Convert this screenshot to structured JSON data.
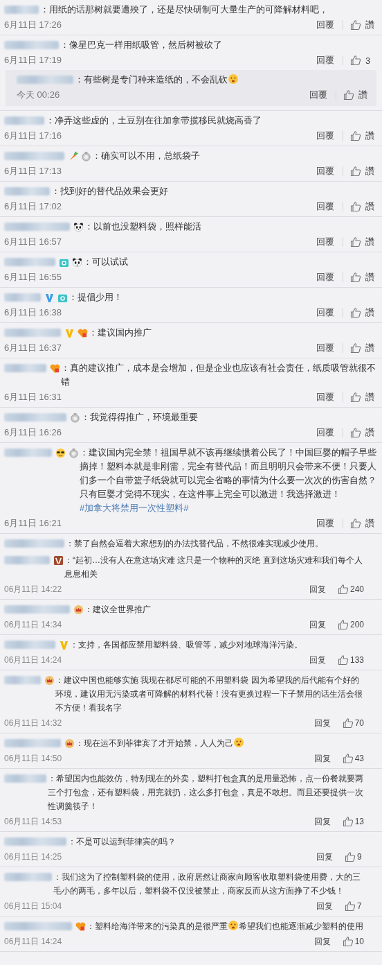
{
  "sections": [
    {
      "kind": "a",
      "comments": [
        {
          "segments": [
            {
              "kind": "text",
              "text": "：用纸的话那树就要遭殃了，还是尽快研制可大量生产的可降解材料吧，"
            }
          ],
          "time": "6月11日 17:26",
          "reply": "回覆",
          "like": "讚"
        },
        {
          "segments": [
            {
              "kind": "text",
              "text": "：像星巴克一样用纸吸管，然后树被砍了"
            }
          ],
          "time": "6月11日 17:19",
          "reply": "回覆",
          "like": "3",
          "replies": [
            {
              "segments": [
                {
                  "kind": "text",
                  "text": "：有些树是专门种来造纸的，不会乱砍"
                },
                {
                  "kind": "emoji"
                }
              ],
              "time": "今天 00:26",
              "reply": "回覆",
              "like": "讚"
            }
          ]
        },
        {
          "segments": [
            {
              "kind": "text",
              "text": "：净弄这些虚的，土豆别在往加拿带揽移民就烧高香了"
            }
          ],
          "time": "6月11日 17:16",
          "reply": "回覆",
          "like": "讚"
        },
        {
          "badges": [
            {
              "kind": "carrot"
            },
            {
              "kind": "medal"
            }
          ],
          "segments": [
            {
              "kind": "text",
              "text": "：确实可以不用，总纸袋子"
            }
          ],
          "time": "6月11日 17:13",
          "reply": "回覆",
          "like": "讚"
        },
        {
          "segments": [
            {
              "kind": "text",
              "text": "：找到好的替代品效果会更好"
            }
          ],
          "time": "6月11日 17:02",
          "reply": "回覆",
          "like": "讚"
        },
        {
          "badges": [
            {
              "kind": "panda"
            }
          ],
          "segments": [
            {
              "kind": "text",
              "text": "：以前也没塑料袋，照样能活"
            }
          ],
          "time": "6月11日 16:57",
          "reply": "回覆",
          "like": "讚"
        },
        {
          "badges": [
            {
              "kind": "camera"
            },
            {
              "kind": "panda"
            }
          ],
          "segments": [
            {
              "kind": "text",
              "text": "：可以试试"
            }
          ],
          "time": "6月11日 16:55",
          "reply": "回覆",
          "like": "讚"
        },
        {
          "badges": [
            {
              "kind": "v-blue"
            },
            {
              "kind": "camera"
            }
          ],
          "segments": [
            {
              "kind": "text",
              "text": "：提倡少用！"
            }
          ],
          "time": "6月11日 16:38",
          "reply": "回覆",
          "like": "讚"
        },
        {
          "badges": [
            {
              "kind": "v-gold"
            },
            {
              "kind": "vip"
            }
          ],
          "segments": [
            {
              "kind": "text",
              "text": "：建议国内推广"
            }
          ],
          "time": "6月11日 16:37",
          "reply": "回覆",
          "like": "讚"
        },
        {
          "badges": [
            {
              "kind": "vip"
            }
          ],
          "segments": [
            {
              "kind": "text",
              "text": "：真的建议推广，成本是会增加，但是企业也应该有社会责任，纸质吸管就很不错"
            }
          ],
          "time": "6月11日 16:31",
          "reply": "回覆",
          "like": "讚"
        },
        {
          "badges": [
            {
              "kind": "medal"
            }
          ],
          "segments": [
            {
              "kind": "text",
              "text": "：我觉得得推广，环境最重要"
            }
          ],
          "time": "6月11日 16:26",
          "reply": "回覆",
          "like": "讚"
        },
        {
          "badges": [
            {
              "kind": "sunglasses"
            },
            {
              "kind": "medal"
            }
          ],
          "segments": [
            {
              "kind": "text",
              "text": "：建议国内完全禁！祖国早就不该再继续惯着公民了！中国巨婴的帽子早些摘掉！塑料本就是非刚需，完全有替代品！而且明明只会带来不便！只要人们多一个自带篮子纸袋就可以完全省略的事情为什么要一次次的伤害自然？只有巨婴才觉得不现实，在这件事上完全可以激进！我选择激进！"
            },
            {
              "kind": "hashtag",
              "text": "#加拿大将禁用一次性塑料#"
            }
          ],
          "time": "6月11日 16:21",
          "reply": "回覆",
          "like": "讚"
        }
      ]
    },
    {
      "kind": "b",
      "comments": [
        {
          "segments": [
            {
              "kind": "text",
              "text": "：禁了自然会逼着大家想别的办法找替代品，不然很难实现减少使用。"
            }
          ]
        },
        {
          "badges": [
            {
              "kind": "v-brown"
            }
          ],
          "segments": [
            {
              "kind": "text",
              "text": "：“起初…没有人在意这场灾难 这只是一个物种的灭绝 直到这场灾难和我们每个人息息相关"
            }
          ],
          "time": "06月11日 14:22",
          "reply": "回复",
          "like": "240"
        },
        {
          "badges": [
            {
              "kind": "crown"
            }
          ],
          "segments": [
            {
              "kind": "text",
              "text": "：建议全世界推广"
            }
          ],
          "time": "06月11日 14:34",
          "reply": "回复",
          "like": "200"
        },
        {
          "badges": [
            {
              "kind": "v-gold"
            }
          ],
          "segments": [
            {
              "kind": "text",
              "text": "：支持，各国都应禁用塑料袋、吸管等，减少对地球海洋污染。"
            }
          ],
          "time": "06月11日 14:24",
          "reply": "回复",
          "like": "133"
        },
        {
          "badges": [
            {
              "kind": "crown"
            }
          ],
          "segments": [
            {
              "kind": "text",
              "text": "：建议中国也能够实施 我现在都尽可能的不用塑料袋 因为希望我的后代能有个好的环境，建议用无污染或者可降解的材料代替！没有更换过程一下子禁用的话生活会很不方便！看我名字"
            }
          ],
          "time": "06月11日 14:32",
          "reply": "回复",
          "like": "70"
        },
        {
          "badges": [
            {
              "kind": "crown"
            }
          ],
          "segments": [
            {
              "kind": "text",
              "text": "：现在运不到菲律宾了才开始禁，人人为己"
            },
            {
              "kind": "emoji"
            }
          ],
          "time": "06月11日 14:50",
          "reply": "回复",
          "like": "43"
        },
        {
          "segments": [
            {
              "kind": "text",
              "text": "：希望国内也能效仿，特别现在的外卖，塑料打包盒真的是用量恐怖，点一份餐就要两三个打包盒，还有塑料袋，用完就扔，这么多打包盒，真是不敢想。而且还要提供一次性调羹筷子！"
            }
          ],
          "time": "06月11日 14:53",
          "reply": "回复",
          "like": "13"
        },
        {
          "segments": [
            {
              "kind": "text",
              "text": "：不是可以运到菲律宾的吗？"
            }
          ],
          "time": "06月11日 14:25",
          "reply": "回复",
          "like": "9"
        },
        {
          "segments": [
            {
              "kind": "text",
              "text": "：我们这为了控制塑料袋的使用，政府居然让商家向顾客收取塑料袋使用费，大的三毛小的两毛，多年以后，塑料袋不仅没被禁止，商家反而从这方面挣了不少钱！"
            }
          ],
          "time": "06月11日 15:04",
          "reply": "回复",
          "like": "7"
        },
        {
          "badges": [
            {
              "kind": "vip"
            }
          ],
          "segments": [
            {
              "kind": "text",
              "text": "：塑料给海洋带来的污染真的是很严重"
            },
            {
              "kind": "emoji"
            },
            {
              "kind": "text",
              "text": "希望我们也能逐渐减少塑料的使用"
            }
          ],
          "time": "06月11日 14:24",
          "reply": "回复",
          "like": "10"
        }
      ]
    }
  ]
}
